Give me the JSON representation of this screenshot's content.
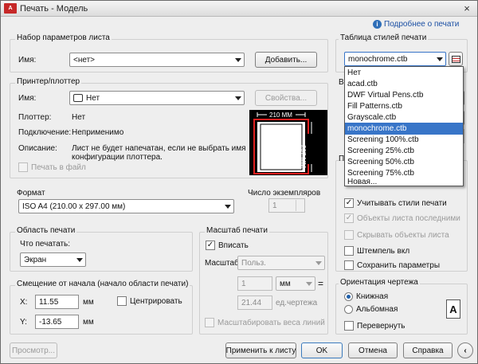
{
  "window": {
    "title": "Печать - Модель",
    "app_icon": "A",
    "help_link": "Подробнее о печати",
    "close": "×"
  },
  "page_setup": {
    "title": "Набор параметров листа",
    "name_label": "Имя:",
    "name_value": "<нет>",
    "add_button": "Добавить..."
  },
  "printer": {
    "title": "Принтер/плоттер",
    "name_label": "Имя:",
    "name_value": "Нет",
    "properties_button": "Свойства...",
    "plotter_label": "Плоттер:",
    "plotter_value": "Нет",
    "connection_label": "Подключение:",
    "connection_value": "Неприменимо",
    "description_label": "Описание:",
    "description_value_1": "Лист не будет напечатан, если не выбрать имя",
    "description_value_2": "конфигурации плоттера.",
    "print_to_file": "Печать в файл"
  },
  "preview": {
    "width_label": "210 ММ",
    "height_label": "297 ММ"
  },
  "format": {
    "title": "Формат",
    "value": "ISO A4 (210.00 x 297.00 мм)"
  },
  "copies": {
    "title": "Число экземпляров",
    "value": "1"
  },
  "print_area": {
    "title": "Область печати",
    "what_label": "Что печатать:",
    "what_value": "Экран"
  },
  "scale": {
    "title": "Масштаб печати",
    "fit_label": "Вписать",
    "fit_checked": true,
    "scale_label": "Масштаб:",
    "scale_value": "Польз.",
    "value1": "1",
    "unit": "мм",
    "value2": "21.44",
    "unit2": "ед.чертежа",
    "scale_lineweights": "Масштабировать веса линий"
  },
  "offset": {
    "title": "Смещение от начала (начало области печати)",
    "x_label": "X:",
    "x_value": "11.55",
    "x_unit": "мм",
    "y_label": "Y:",
    "y_value": "-13.65",
    "y_unit": "мм",
    "center_label": "Центрировать"
  },
  "style_table": {
    "title": "Таблица стилей печати",
    "value": "monochrome.ctb",
    "items": [
      "Нет",
      "acad.ctb",
      "DWF Virtual Pens.ctb",
      "Fill Patterns.ctb",
      "Grayscale.ctb",
      "monochrome.ctb",
      "Screening 100%.ctb",
      "Screening 25%.ctb",
      "Screening 50%.ctb",
      "Screening 75%.ctb",
      "Новая..."
    ],
    "selected_index": 5,
    "peek_label_1": "В",
    "peek_label_2": "П"
  },
  "options": {
    "use_styles": "Учитывать стили печати",
    "paperspace_last": "Объекты листа последними",
    "hide_objects": "Скрывать объекты листа",
    "stamp_on": "Штемпель вкл",
    "save_params": "Сохранить параметры",
    "check_mark": "✓"
  },
  "orientation": {
    "title": "Ориентация чертежа",
    "portrait": "Книжная",
    "landscape": "Альбомная",
    "upside_down": "Перевернуть",
    "icon_letter": "A"
  },
  "bottom": {
    "preview": "Просмотр...",
    "apply": "Применить к листу",
    "ok": "OK",
    "cancel": "Отмена",
    "help": "Справка",
    "more": "‹"
  },
  "colors": {
    "selection": "#3875c8",
    "preview_red": "#e0201f"
  }
}
